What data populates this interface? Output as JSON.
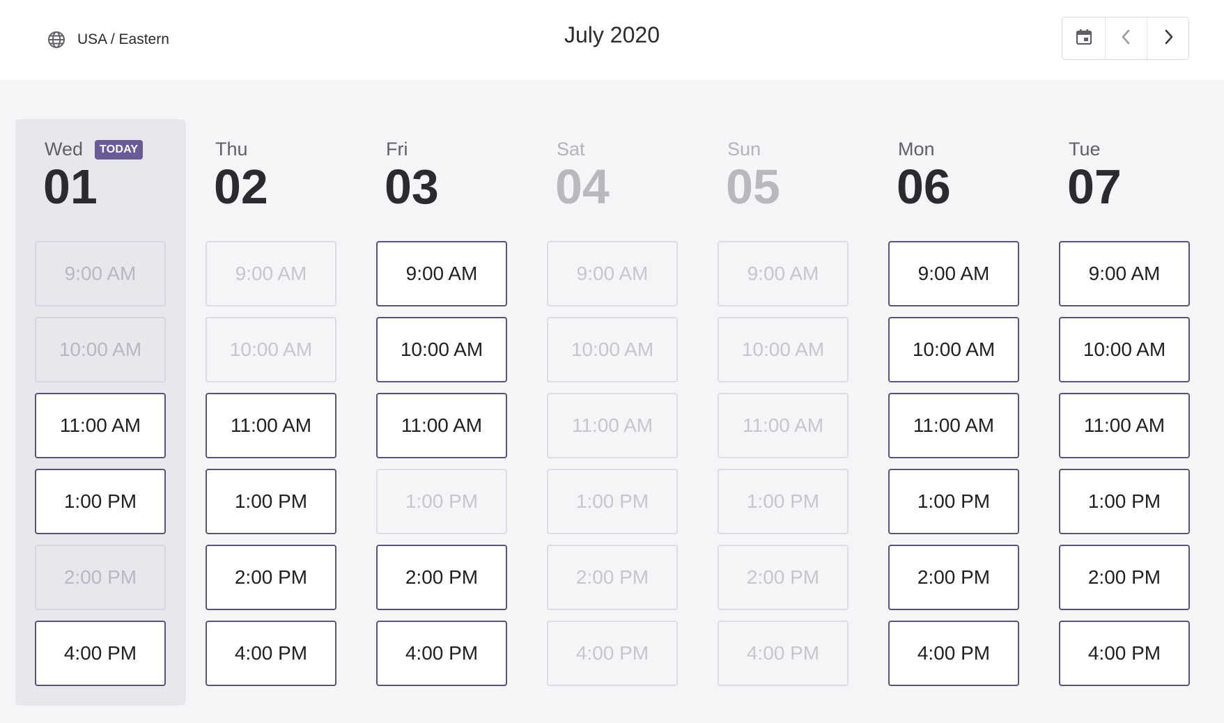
{
  "header": {
    "timezone_label": "USA / Eastern",
    "month_title": "July 2020",
    "nav": {
      "calendar_icon": "calendar-icon",
      "prev_icon": "chevron-left-icon",
      "next_icon": "chevron-right-icon"
    }
  },
  "today_badge": "TODAY",
  "colors": {
    "accent": "#6a5b97",
    "slot_border": "#5d5175",
    "page_bg": "#f5f5f8",
    "today_bg": "#e8e7ee"
  },
  "days": [
    {
      "dow": "Wed",
      "date": "01",
      "today": true,
      "off": false,
      "slots": [
        {
          "time": "9:00 AM",
          "available": false
        },
        {
          "time": "10:00 AM",
          "available": false
        },
        {
          "time": "11:00 AM",
          "available": true
        },
        {
          "time": "1:00 PM",
          "available": true
        },
        {
          "time": "2:00 PM",
          "available": false
        },
        {
          "time": "4:00 PM",
          "available": true
        }
      ]
    },
    {
      "dow": "Thu",
      "date": "02",
      "today": false,
      "off": false,
      "slots": [
        {
          "time": "9:00 AM",
          "available": false
        },
        {
          "time": "10:00 AM",
          "available": false
        },
        {
          "time": "11:00 AM",
          "available": true
        },
        {
          "time": "1:00 PM",
          "available": true
        },
        {
          "time": "2:00 PM",
          "available": true
        },
        {
          "time": "4:00 PM",
          "available": true
        }
      ]
    },
    {
      "dow": "Fri",
      "date": "03",
      "today": false,
      "off": false,
      "slots": [
        {
          "time": "9:00 AM",
          "available": true
        },
        {
          "time": "10:00 AM",
          "available": true
        },
        {
          "time": "11:00 AM",
          "available": true
        },
        {
          "time": "1:00 PM",
          "available": false
        },
        {
          "time": "2:00 PM",
          "available": true
        },
        {
          "time": "4:00 PM",
          "available": true
        }
      ]
    },
    {
      "dow": "Sat",
      "date": "04",
      "today": false,
      "off": true,
      "slots": [
        {
          "time": "9:00 AM",
          "available": false
        },
        {
          "time": "10:00 AM",
          "available": false
        },
        {
          "time": "11:00 AM",
          "available": false
        },
        {
          "time": "1:00 PM",
          "available": false
        },
        {
          "time": "2:00 PM",
          "available": false
        },
        {
          "time": "4:00 PM",
          "available": false
        }
      ]
    },
    {
      "dow": "Sun",
      "date": "05",
      "today": false,
      "off": true,
      "slots": [
        {
          "time": "9:00 AM",
          "available": false
        },
        {
          "time": "10:00 AM",
          "available": false
        },
        {
          "time": "11:00 AM",
          "available": false
        },
        {
          "time": "1:00 PM",
          "available": false
        },
        {
          "time": "2:00 PM",
          "available": false
        },
        {
          "time": "4:00 PM",
          "available": false
        }
      ]
    },
    {
      "dow": "Mon",
      "date": "06",
      "today": false,
      "off": false,
      "slots": [
        {
          "time": "9:00 AM",
          "available": true
        },
        {
          "time": "10:00 AM",
          "available": true
        },
        {
          "time": "11:00 AM",
          "available": true
        },
        {
          "time": "1:00 PM",
          "available": true
        },
        {
          "time": "2:00 PM",
          "available": true
        },
        {
          "time": "4:00 PM",
          "available": true
        }
      ]
    },
    {
      "dow": "Tue",
      "date": "07",
      "today": false,
      "off": false,
      "slots": [
        {
          "time": "9:00 AM",
          "available": true
        },
        {
          "time": "10:00 AM",
          "available": true
        },
        {
          "time": "11:00 AM",
          "available": true
        },
        {
          "time": "1:00 PM",
          "available": true
        },
        {
          "time": "2:00 PM",
          "available": true
        },
        {
          "time": "4:00 PM",
          "available": true
        }
      ]
    }
  ]
}
